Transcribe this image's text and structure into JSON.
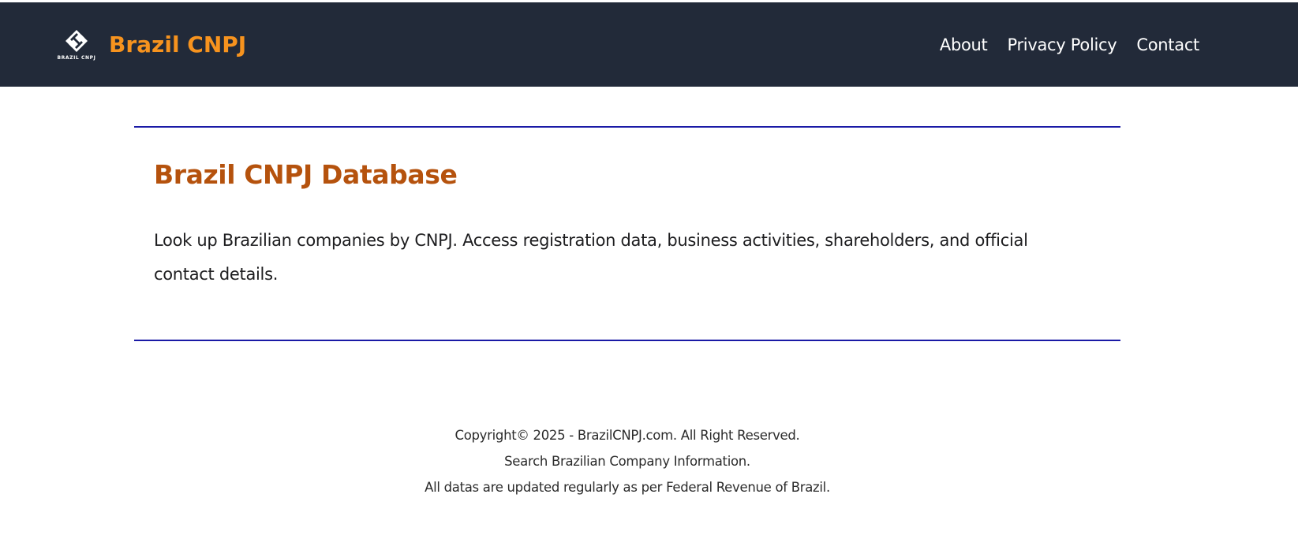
{
  "header": {
    "logo_text": "BRAZIL CNPJ",
    "brand_name": "Brazil CNPJ",
    "nav": [
      {
        "label": "About"
      },
      {
        "label": "Privacy Policy"
      },
      {
        "label": "Contact"
      }
    ]
  },
  "main": {
    "title": "Brazil CNPJ Database",
    "description": "Look up Brazilian companies by CNPJ. Access registration data, business activities, shareholders, and official contact details."
  },
  "footer": {
    "copyright": "Copyright© 2025 - BrazilCNPJ.com. All Right Reserved.",
    "tagline": "Search Brazilian Company Information.",
    "update_note": "All datas are updated regularly as per Federal Revenue of Brazil."
  },
  "colors": {
    "header_bg": "#222a39",
    "brand_orange": "#f7931e",
    "title_orange": "#b5520d",
    "rule_blue": "#1a1aa6"
  }
}
